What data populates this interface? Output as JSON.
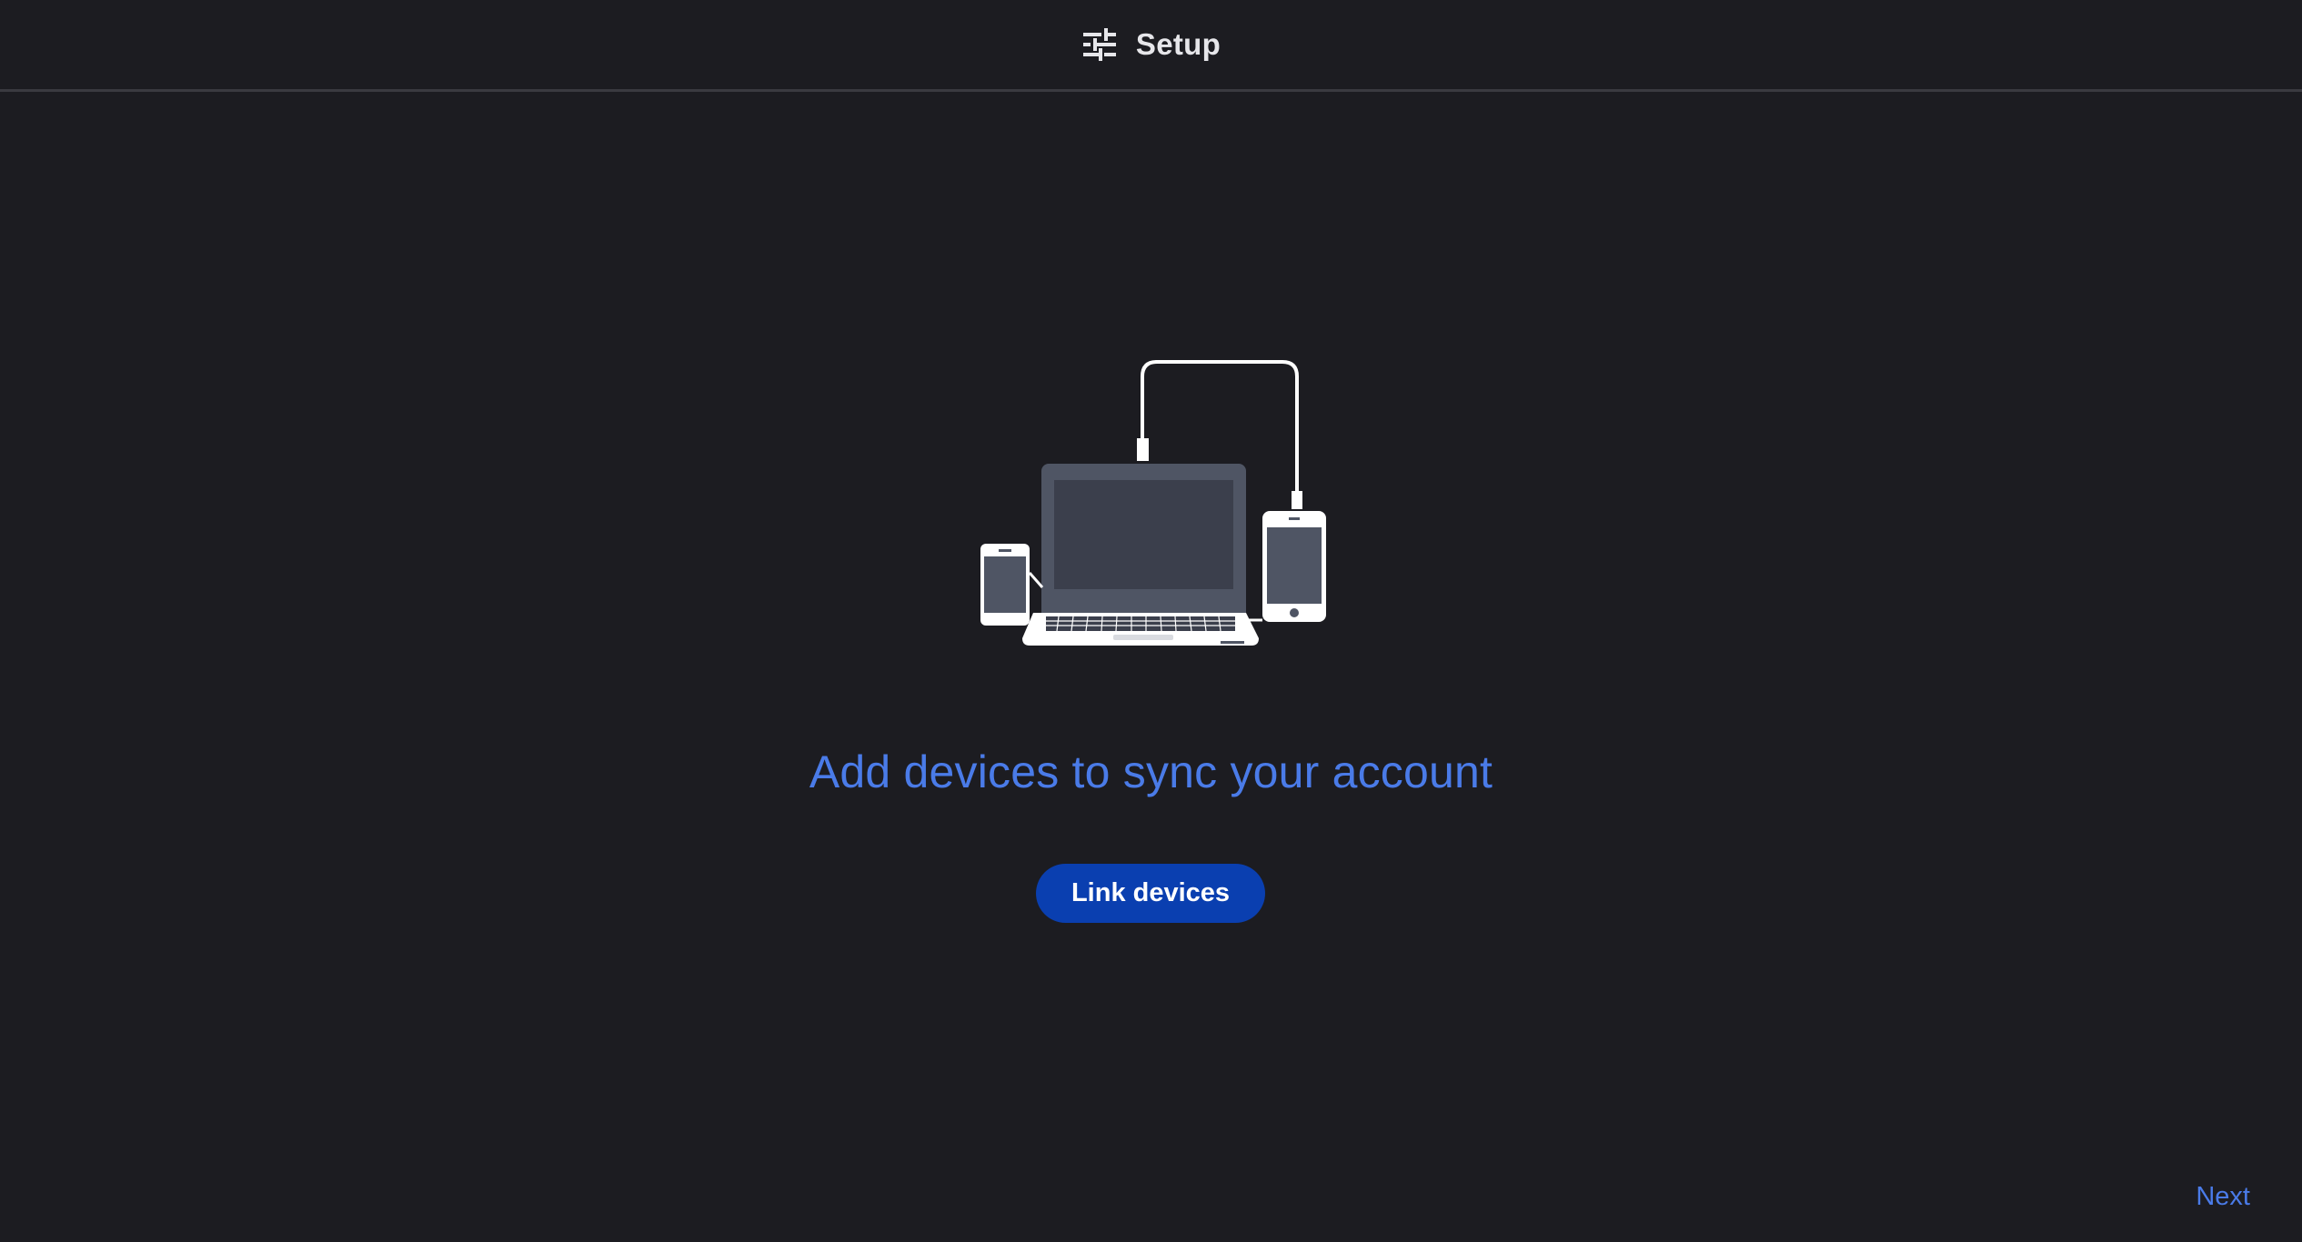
{
  "header": {
    "icon": "sliders-icon",
    "title": "Setup"
  },
  "illustration": {
    "icon": "devices-sync-illustration"
  },
  "main": {
    "headline": "Add devices to sync your account",
    "link_button_label": "Link devices"
  },
  "footer": {
    "next_label": "Next"
  },
  "colors": {
    "background": "#1c1c21",
    "accent": "#4a7be8",
    "button": "#0a3fb0",
    "divider": "#3a3a40"
  }
}
